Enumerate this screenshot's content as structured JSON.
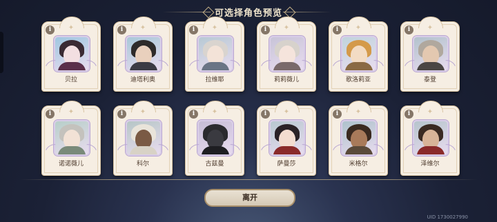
{
  "header": {
    "title": "可选择角色预览"
  },
  "row1": [
    {
      "name": "贝拉",
      "bg": "#9fc7e0",
      "hair": "#3a2a33",
      "skin": "#f3dfe1",
      "outfit": "#5a2f4a"
    },
    {
      "name": "迪塔利奥",
      "bg": "#a8c8d8",
      "hair": "#2e2b2a",
      "skin": "#e9d0bd",
      "outfit": "#3b3b44"
    },
    {
      "name": "拉维耶",
      "bg": "#b7c9d4",
      "hair": "#d9d4cf",
      "skin": "#f3e3d8",
      "outfit": "#6a7585"
    },
    {
      "name": "莉莉薇儿",
      "bg": "#c8c4d8",
      "hair": "#d7d2cc",
      "skin": "#f5e4dc",
      "outfit": "#7a6a6a"
    },
    {
      "name": "歌洛莉亚",
      "bg": "#c0d4dc",
      "hair": "#d49a4a",
      "skin": "#f3dcc4",
      "outfit": "#8a6a44"
    },
    {
      "name": "泰登",
      "bg": "#b2c2cc",
      "hair": "#b0a89e",
      "skin": "#e3c8b0",
      "outfit": "#4a4644"
    }
  ],
  "row2": [
    {
      "name": "诺诺薇儿",
      "bg": "#b7cfc9",
      "hair": "#c4c2bd",
      "skin": "#f2e2d6",
      "outfit": "#7a8a7a"
    },
    {
      "name": "科尔",
      "bg": "#b6c6c6",
      "hair": "#e9e4da",
      "skin": "#7a5a44",
      "outfit": "#d8d2c6"
    },
    {
      "name": "古兹曼",
      "bg": "#c6bcd6",
      "hair": "#2a2a2e",
      "skin": "#3a3a40",
      "outfit": "#1e1e22"
    },
    {
      "name": "萨曼莎",
      "bg": "#b8c8d0",
      "hair": "#2a2226",
      "skin": "#f3dcd0",
      "outfit": "#8a2a2a"
    },
    {
      "name": "米格尔",
      "bg": "#aec2cc",
      "hair": "#3a2a20",
      "skin": "#a87a5a",
      "outfit": "#5a4a3a"
    },
    {
      "name": "泽维尔",
      "bg": "#b6c4cc",
      "hair": "#3a2a22",
      "skin": "#d8b498",
      "outfit": "#8a2a2a"
    }
  ],
  "footer": {
    "leave_label": "离开",
    "uid_text": "UID 1730027990"
  },
  "icons": {
    "info": "info-icon",
    "sparkle": "sparkle-icon"
  },
  "colors": {
    "card": "#f6eee3",
    "border": "#d8c3a2",
    "name": "#4d3a2c"
  }
}
